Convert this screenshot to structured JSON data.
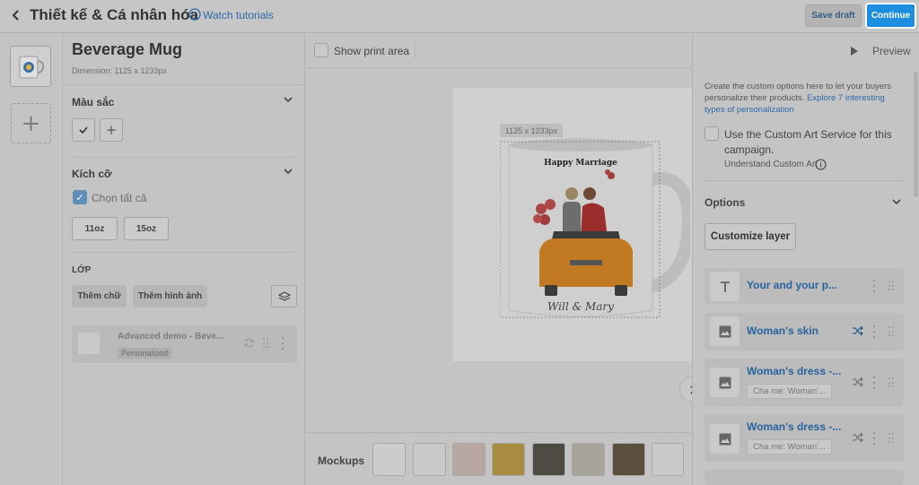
{
  "header": {
    "title": "Thiết kế & Cá nhân hóa",
    "tutorials_label": "Watch tutorials",
    "save_draft_label": "Save draft",
    "continue_label": "Continue"
  },
  "product": {
    "title": "Beverage Mug",
    "dimension": "Dimension: 1125 x 1233px"
  },
  "color_section": {
    "label": "Màu sắc"
  },
  "size_section": {
    "label": "Kích cỡ",
    "select_all_label": "Chọn tất cả",
    "sizes": [
      "11oz",
      "15oz"
    ]
  },
  "layer_section": {
    "label": "LỚP",
    "add_text_label": "Thêm chữ",
    "add_image_label": "Thêm hình ảnh",
    "layer_name": "Advanced demo - Beve...",
    "layer_badge": "Personalized"
  },
  "canvas": {
    "show_print_area_label": "Show print area",
    "dimension_badge": "1125 x 1233px",
    "mug_text_top": "Happy Marriage",
    "mug_text_bottom": "Will & Mary"
  },
  "mockups": {
    "label": "Mockups"
  },
  "right_panel": {
    "preview_label": "Preview",
    "intro_text": "Create the custom options here to let your buyers personalize their products. ",
    "intro_link": "Explore 7 interesting types of personalization",
    "custom_art_label": "Use the Custom Art Service for this campaign.",
    "understand_label": "Understand Custom Art",
    "options_title": "Options",
    "customize_layer_label": "Customize layer",
    "options": [
      {
        "title": "Your and your p...",
        "icon": "text-icon",
        "sub": ""
      },
      {
        "title": "Woman's skin",
        "icon": "image-icon",
        "sub": ""
      },
      {
        "title": "Woman's dress -...",
        "icon": "image-icon",
        "sub": "Cha me: Woman'..."
      },
      {
        "title": "Woman's dress -...",
        "icon": "image-icon",
        "sub": "Cha me: Woman'..."
      }
    ]
  },
  "colors": {
    "accent": "#1e8fe0",
    "link": "#2c6aa8",
    "overlay_bg": "#c4c4c4"
  }
}
